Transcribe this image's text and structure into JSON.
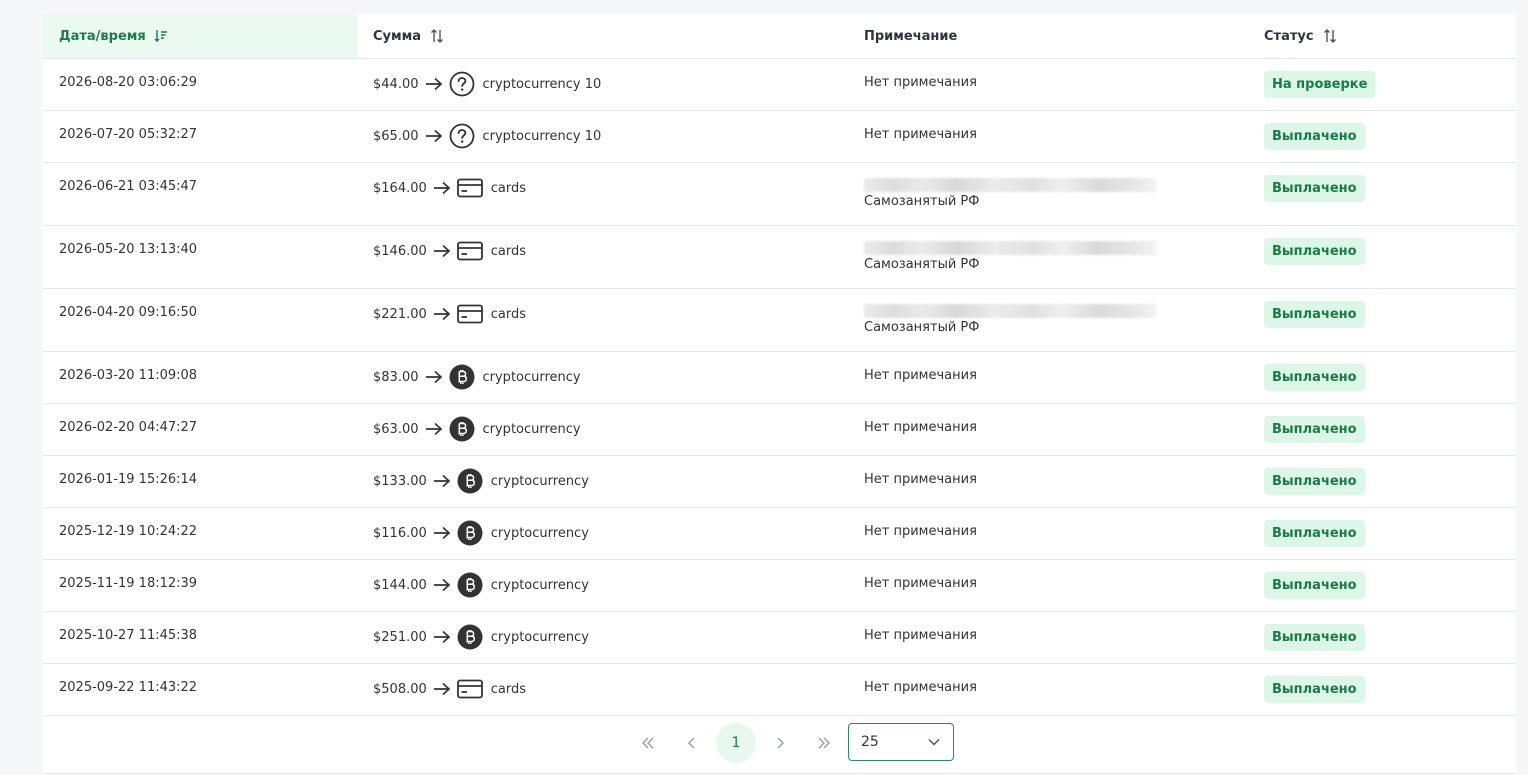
{
  "table": {
    "headers": {
      "date": "Дата/время",
      "amount": "Сумма",
      "note": "Примечание",
      "status": "Статус"
    },
    "rows": [
      {
        "date": "2026-08-20 03:06:29",
        "amount": "$44.00",
        "method": "cryptocurrency 10",
        "icon": "question-circle-icon",
        "note": "Нет примечания",
        "note_redacted": false,
        "status": "На проверке"
      },
      {
        "date": "2026-07-20 05:32:27",
        "amount": "$65.00",
        "method": "cryptocurrency 10",
        "icon": "question-circle-icon",
        "note": "Нет примечания",
        "note_redacted": false,
        "status": "Выплачено"
      },
      {
        "date": "2026-06-21 03:45:47",
        "amount": "$164.00",
        "method": "cards",
        "icon": "card-icon",
        "note": "Самозанятый РФ",
        "note_redacted": true,
        "status": "Выплачено"
      },
      {
        "date": "2026-05-20 13:13:40",
        "amount": "$146.00",
        "method": "cards",
        "icon": "card-icon",
        "note": "Самозанятый РФ",
        "note_redacted": true,
        "status": "Выплачено"
      },
      {
        "date": "2026-04-20 09:16:50",
        "amount": "$221.00",
        "method": "cards",
        "icon": "card-icon",
        "note": "Самозанятый РФ",
        "note_redacted": true,
        "status": "Выплачено"
      },
      {
        "date": "2026-03-20 11:09:08",
        "amount": "$83.00",
        "method": "cryptocurrency",
        "icon": "bitcoin-icon",
        "note": "Нет примечания",
        "note_redacted": false,
        "status": "Выплачено"
      },
      {
        "date": "2026-02-20 04:47:27",
        "amount": "$63.00",
        "method": "cryptocurrency",
        "icon": "bitcoin-icon",
        "note": "Нет примечания",
        "note_redacted": false,
        "status": "Выплачено"
      },
      {
        "date": "2026-01-19 15:26:14",
        "amount": "$133.00",
        "method": "cryptocurrency",
        "icon": "bitcoin-icon",
        "note": "Нет примечания",
        "note_redacted": false,
        "status": "Выплачено"
      },
      {
        "date": "2025-12-19 10:24:22",
        "amount": "$116.00",
        "method": "cryptocurrency",
        "icon": "bitcoin-icon",
        "note": "Нет примечания",
        "note_redacted": false,
        "status": "Выплачено"
      },
      {
        "date": "2025-11-19 18:12:39",
        "amount": "$144.00",
        "method": "cryptocurrency",
        "icon": "bitcoin-icon",
        "note": "Нет примечания",
        "note_redacted": false,
        "status": "Выплачено"
      },
      {
        "date": "2025-10-27 11:45:38",
        "amount": "$251.00",
        "method": "cryptocurrency",
        "icon": "bitcoin-icon",
        "note": "Нет примечания",
        "note_redacted": false,
        "status": "Выплачено"
      },
      {
        "date": "2025-09-22 11:43:22",
        "amount": "$508.00",
        "method": "cards",
        "icon": "card-icon",
        "note": "Нет примечания",
        "note_redacted": false,
        "status": "Выплачено"
      }
    ]
  },
  "pagination": {
    "current_page": "1",
    "page_size": "25"
  },
  "colors": {
    "accent": "#1a7a48",
    "badge_bg": "#dcf7e7",
    "header_active_bg": "#eafaf1"
  }
}
